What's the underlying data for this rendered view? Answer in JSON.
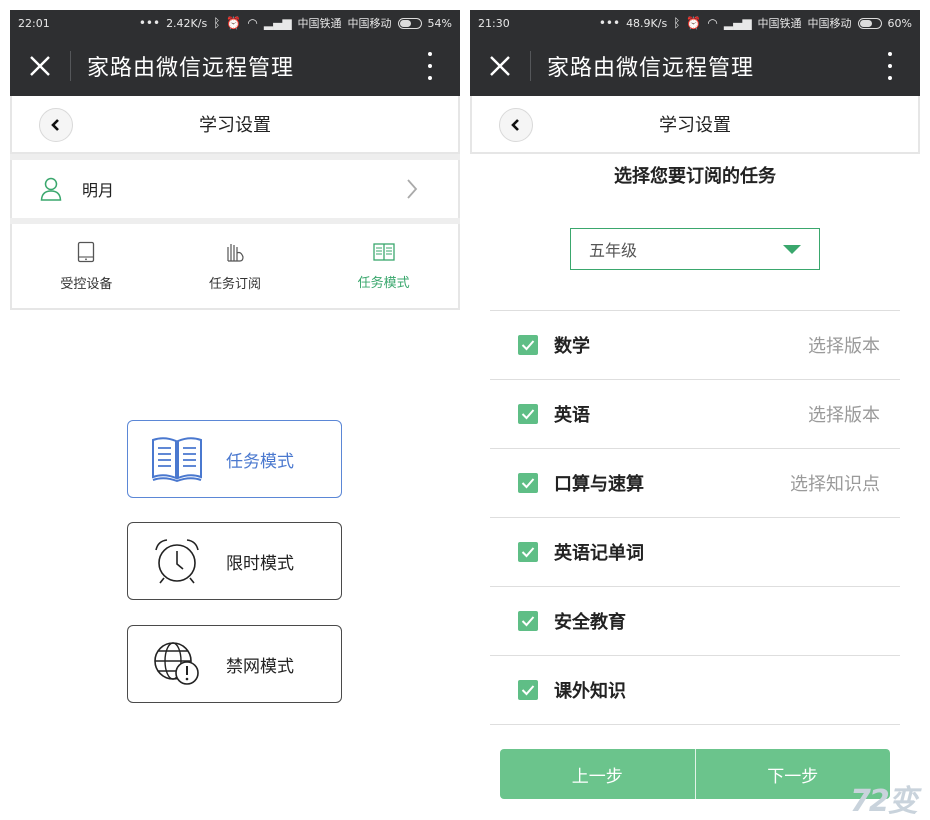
{
  "left": {
    "status": {
      "time": "22:01",
      "speed": "2.42K/s",
      "carrier1": "中国铁通",
      "carrier2": "中国移动",
      "battery": "54%",
      "battery_level": 0.54
    },
    "appbar": {
      "title": "家路由微信远程管理"
    },
    "subheader": {
      "title": "学习设置"
    },
    "user": {
      "name": "明月"
    },
    "nav": [
      {
        "label": "受控设备",
        "icon": "tablet-icon",
        "active": false
      },
      {
        "label": "任务订阅",
        "icon": "hand-icon",
        "active": false
      },
      {
        "label": "任务模式",
        "icon": "book-icon",
        "active": true
      }
    ],
    "modes": [
      {
        "label": "任务模式",
        "icon": "open-book-icon",
        "active": true
      },
      {
        "label": "限时模式",
        "icon": "alarm-clock-icon",
        "active": false
      },
      {
        "label": "禁网模式",
        "icon": "globe-warning-icon",
        "active": false
      }
    ]
  },
  "right": {
    "status": {
      "time": "21:30",
      "speed": "48.9K/s",
      "carrier1": "中国铁通",
      "carrier2": "中国移动",
      "battery": "60%",
      "battery_level": 0.6
    },
    "appbar": {
      "title": "家路由微信远程管理"
    },
    "subheader": {
      "title": "学习设置"
    },
    "section_title": "选择您要订阅的任务",
    "grade": {
      "value": "五年级"
    },
    "tasks": [
      {
        "name": "数学",
        "action": "选择版本",
        "checked": true
      },
      {
        "name": "英语",
        "action": "选择版本",
        "checked": true
      },
      {
        "name": "口算与速算",
        "action": "选择知识点",
        "checked": true
      },
      {
        "name": "英语记单词",
        "action": "",
        "checked": true
      },
      {
        "name": "安全教育",
        "action": "",
        "checked": true
      },
      {
        "name": "课外知识",
        "action": "",
        "checked": true
      }
    ],
    "buttons": {
      "prev": "上一步",
      "next": "下一步"
    }
  },
  "watermark": "72变",
  "colors": {
    "green": "#3aa76d",
    "checkbox": "#5fbe86",
    "button": "#6bc48c",
    "blue": "#4a78cf",
    "appbar": "#2e2f31"
  }
}
